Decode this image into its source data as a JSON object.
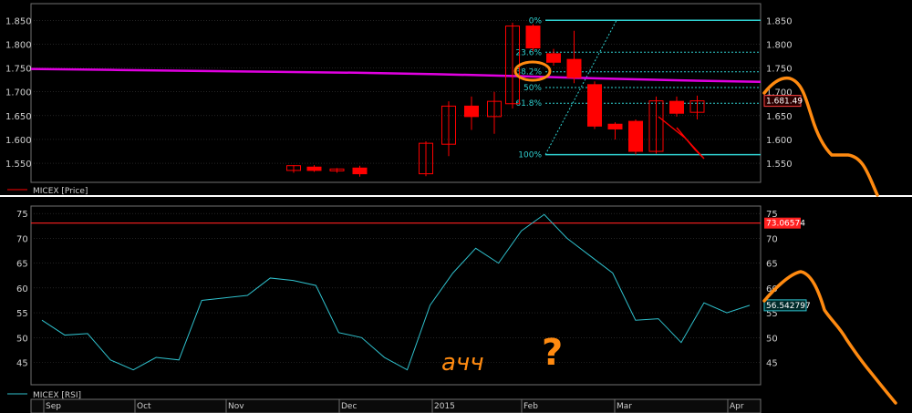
{
  "colors": {
    "background": "#000000",
    "grid": "#3a3a3a",
    "frame": "#6f6f6f",
    "candle": "#ff0000",
    "moving_average": "#e000e0",
    "fibonacci": "#2fd0d0",
    "rsi_line": "#2fc0cc",
    "rsi_level": "#ff2020",
    "annotation": "#ff8a10",
    "separator": "#ffffff"
  },
  "chart_data": [
    {
      "type": "candlestick",
      "legend": "MICEX [Price]",
      "y_ticks": [
        "1.850",
        "1.800",
        "1.750",
        "1.700",
        "1.650",
        "1.600",
        "1.550"
      ],
      "ylim": [
        1510,
        1885
      ],
      "last_value_label": "1.681.49",
      "moving_average": [
        1748,
        1746,
        1744,
        1742,
        1740,
        1737,
        1733,
        1728,
        1724,
        1721
      ],
      "candles": [
        {
          "x": 11.2,
          "open": 1535,
          "close": 1545,
          "high": 1546,
          "low": 1530
        },
        {
          "x": 12.1,
          "open": 1542,
          "close": 1535,
          "high": 1546,
          "low": 1532
        },
        {
          "x": 13.1,
          "open": 1534,
          "close": 1538,
          "high": 1540,
          "low": 1530
        },
        {
          "x": 14.1,
          "open": 1540,
          "close": 1528,
          "high": 1545,
          "low": 1522
        },
        {
          "x": 17.0,
          "open": 1528,
          "close": 1592,
          "high": 1596,
          "low": 1523
        },
        {
          "x": 18.0,
          "open": 1590,
          "close": 1670,
          "high": 1680,
          "low": 1565
        },
        {
          "x": 19.0,
          "open": 1670,
          "close": 1648,
          "high": 1690,
          "low": 1620
        },
        {
          "x": 20.0,
          "open": 1648,
          "close": 1680,
          "high": 1700,
          "low": 1612
        },
        {
          "x": 20.8,
          "open": 1675,
          "close": 1838,
          "high": 1845,
          "low": 1665
        },
        {
          "x": 21.7,
          "open": 1838,
          "close": 1792,
          "high": 1842,
          "low": 1785
        },
        {
          "x": 22.6,
          "open": 1780,
          "close": 1762,
          "high": 1790,
          "low": 1755
        },
        {
          "x": 23.5,
          "open": 1768,
          "close": 1730,
          "high": 1828,
          "low": 1718
        },
        {
          "x": 24.4,
          "open": 1715,
          "close": 1628,
          "high": 1722,
          "low": 1622
        },
        {
          "x": 25.3,
          "open": 1632,
          "close": 1622,
          "high": 1636,
          "low": 1600
        },
        {
          "x": 26.2,
          "open": 1638,
          "close": 1575,
          "high": 1642,
          "low": 1568
        },
        {
          "x": 27.1,
          "open": 1575,
          "close": 1681,
          "high": 1690,
          "low": 1570
        },
        {
          "x": 28.0,
          "open": 1680,
          "close": 1655,
          "high": 1690,
          "low": 1648
        },
        {
          "x": 28.9,
          "open": 1657,
          "close": 1681,
          "high": 1692,
          "low": 1642
        }
      ],
      "fibonacci": {
        "high": 1850,
        "low": 1568,
        "levels": [
          {
            "label": "0%",
            "value": 1850
          },
          {
            "label": "23.6%",
            "value": 1783
          },
          {
            "label": "38.2%",
            "value": 1742
          },
          {
            "label": "50%",
            "value": 1709
          },
          {
            "label": "61.8%",
            "value": 1676
          },
          {
            "label": "100%",
            "value": 1568
          }
        ]
      }
    },
    {
      "type": "line",
      "legend": "MICEX [RSI]",
      "y_ticks": [
        "75",
        "70",
        "65",
        "60",
        "55",
        "50",
        "45"
      ],
      "ylim": [
        40.5,
        76.5
      ],
      "reference_level": 73.06574,
      "reference_label": "73.06574",
      "last_value_label": "56.542797",
      "x_labels": [
        "Sep",
        "Oct",
        "Nov",
        "Dec",
        "2015",
        "Feb",
        "Mar",
        "Apr"
      ],
      "series": [
        {
          "values": [
            53.5,
            50.5,
            50.8,
            45.5,
            43.5,
            46,
            45.5,
            57.5,
            58,
            58.5,
            62,
            61.5,
            60.5,
            51,
            50,
            46,
            43.5,
            56.5,
            63,
            68,
            65,
            71.5,
            74.8,
            70,
            66.5,
            63,
            53.5,
            53.8,
            49,
            57,
            55,
            56.5
          ]
        }
      ]
    }
  ],
  "annotations": {
    "text": "ачч",
    "question_mark": "?"
  }
}
